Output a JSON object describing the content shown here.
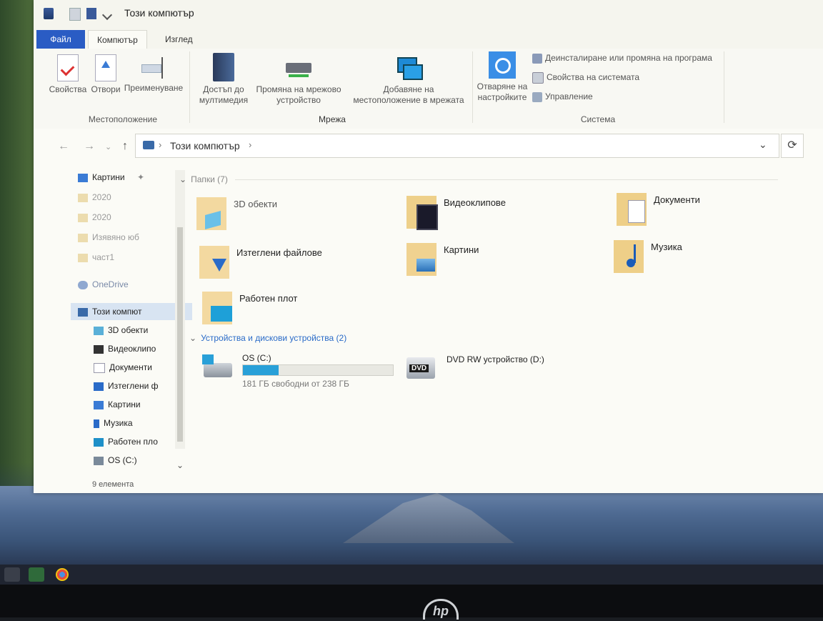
{
  "window": {
    "title": "Този компютър"
  },
  "tabs": {
    "file": "Файл",
    "computer": "Компютър",
    "view": "Изглед"
  },
  "ribbon": {
    "location": {
      "label": "Местоположение",
      "properties": "Свойства",
      "open": "Отвори",
      "rename": "Преименуване"
    },
    "network": {
      "label": "Мрежа",
      "media_access": [
        "Достъп до",
        "мултимедия"
      ],
      "map_drive": [
        "Промяна на мрежово",
        "устройство"
      ],
      "add_location": [
        "Добавяне на",
        "местоположение в мрежата"
      ]
    },
    "system": {
      "label": "Система",
      "open_settings": [
        "Отваряне на",
        "настройките"
      ],
      "uninstall": "Деинсталиране или промяна на програма",
      "system_properties": "Свойства на системата",
      "manage": "Управление"
    }
  },
  "address": {
    "path": "Този компютър"
  },
  "sidebar": {
    "items": [
      {
        "label": "Картини",
        "icon": "pictures-icon"
      },
      {
        "label": "2020",
        "icon": "folder-icon"
      },
      {
        "label": "2020",
        "icon": "folder-icon"
      },
      {
        "label": "Изявяно юб",
        "icon": "folder-icon"
      },
      {
        "label": "част1",
        "icon": "folder-icon"
      },
      {
        "label": "OneDrive",
        "icon": "cloud-icon"
      },
      {
        "label": "Този компют",
        "icon": "computer-icon"
      },
      {
        "label": "3D обекти",
        "icon": "cube-icon"
      },
      {
        "label": "Видеоклипо",
        "icon": "video-icon"
      },
      {
        "label": "Документи",
        "icon": "document-icon"
      },
      {
        "label": "Изтеглени ф",
        "icon": "download-icon"
      },
      {
        "label": "Картини",
        "icon": "pictures-icon"
      },
      {
        "label": "Музика",
        "icon": "music-icon"
      },
      {
        "label": "Работен пло",
        "icon": "desktop-icon"
      },
      {
        "label": "OS (C:)",
        "icon": "drive-icon"
      }
    ]
  },
  "status": {
    "count": "9 елемента"
  },
  "main": {
    "folders_header": "Папки (7)",
    "folders": [
      {
        "label": "3D обекти",
        "icon": "cube-folder-icon"
      },
      {
        "label": "Видеоклипове",
        "icon": "video-folder-icon"
      },
      {
        "label": "Документи",
        "icon": "document-folder-icon"
      },
      {
        "label": "Изтеглени файлове",
        "icon": "download-folder-icon"
      },
      {
        "label": "Картини",
        "icon": "pictures-folder-icon"
      },
      {
        "label": "Музика",
        "icon": "music-folder-icon"
      },
      {
        "label": "Работен плот",
        "icon": "desktop-folder-icon"
      }
    ],
    "devices_header": "Устройства и дискови устройства (2)",
    "drives": [
      {
        "label": "OS (C:)",
        "free": "181 ГБ свободни от 238 ГБ",
        "used_fraction": 0.24
      },
      {
        "label": "DVD RW устройство (D:)",
        "badge": "DVD"
      }
    ]
  },
  "colors": {
    "accent": "#2a5cc4",
    "link": "#2a6bc8",
    "drive_bar": "#29a0d8",
    "folder": "#f0c860"
  }
}
